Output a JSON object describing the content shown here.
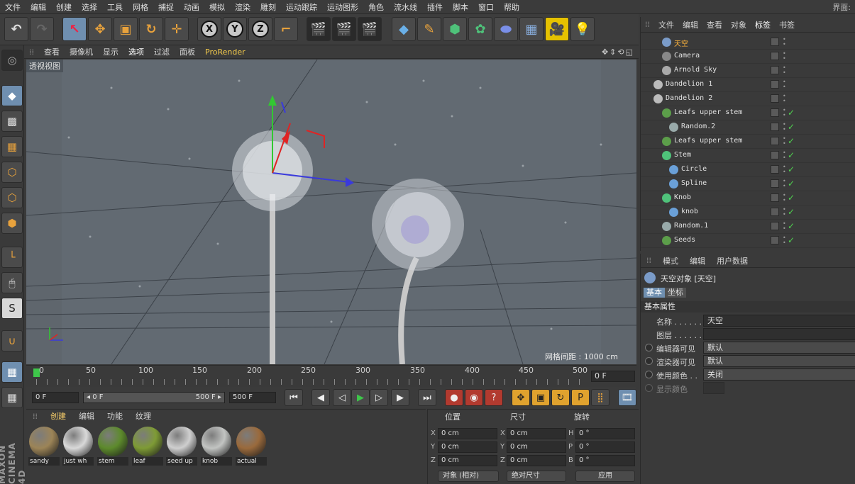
{
  "menubar": {
    "items": [
      "文件",
      "编辑",
      "创建",
      "选择",
      "工具",
      "网格",
      "捕捉",
      "动画",
      "模拟",
      "渲染",
      "雕刻",
      "运动跟踪",
      "运动图形",
      "角色",
      "流水线",
      "插件",
      "脚本",
      "窗口",
      "帮助"
    ],
    "layout_label": "界面:"
  },
  "toolbar": {
    "axis_x": "X",
    "axis_y": "Y",
    "axis_z": "Z"
  },
  "viewport": {
    "menu": [
      "查看",
      "摄像机",
      "显示",
      "选项",
      "过滤",
      "面板",
      "ProRender"
    ],
    "label": "透视视图",
    "grid_spacing": "网格间距 : 1000 cm"
  },
  "timeline": {
    "ticks": [
      "0",
      "50",
      "100",
      "150",
      "200",
      "250",
      "300",
      "350",
      "400",
      "450",
      "500"
    ],
    "current_frame": "0 F"
  },
  "transport": {
    "start_field": "0 F",
    "range_start": "◂ 0 F",
    "range_end": "500 F ▸",
    "end_field": "500 F"
  },
  "materials": {
    "tabs": [
      "创建",
      "编辑",
      "功能",
      "纹理"
    ],
    "items": [
      {
        "name": "sandy",
        "color": "#9c8457"
      },
      {
        "name": "just wh",
        "color": "#d9d9d9"
      },
      {
        "name": "stem",
        "color": "#5d8a2c"
      },
      {
        "name": "leaf",
        "color": "#7e9b35"
      },
      {
        "name": "seed up",
        "color": "#cfcfcf"
      },
      {
        "name": "knob",
        "color": "#c2c4c2"
      },
      {
        "name": "actual",
        "color": "#9a6a3c"
      }
    ]
  },
  "coords": {
    "headers": [
      "位置",
      "尺寸",
      "旋转"
    ],
    "rows": [
      {
        "l1": "X",
        "v1": "0 cm",
        "l2": "X",
        "v2": "0 cm",
        "l3": "H",
        "v3": "0 °"
      },
      {
        "l1": "Y",
        "v1": "0 cm",
        "l2": "Y",
        "v2": "0 cm",
        "l3": "P",
        "v3": "0 °"
      },
      {
        "l1": "Z",
        "v1": "0 cm",
        "l2": "Z",
        "v2": "0 cm",
        "l3": "B",
        "v3": "0 °"
      }
    ],
    "mode_select": "对象 (相对)",
    "size_select": "绝对尺寸",
    "apply": "应用"
  },
  "object_manager": {
    "menu": [
      "文件",
      "编辑",
      "查看",
      "对象",
      "标签",
      "书签"
    ],
    "objects": [
      {
        "name": "天空",
        "selected": true,
        "color": "#7a9bc8",
        "check": false
      },
      {
        "name": "Camera",
        "selected": false,
        "color": "#888",
        "check": false
      },
      {
        "name": "Arnold Sky",
        "selected": false,
        "color": "#aaa",
        "check": false
      },
      {
        "name": "Dandelion 1",
        "selected": false,
        "color": "#bbb",
        "check": false
      },
      {
        "name": "Dandelion 2",
        "selected": false,
        "color": "#bbb",
        "check": false
      },
      {
        "name": "Leafs upper stem",
        "selected": false,
        "color": "#5c9e4a",
        "check": true
      },
      {
        "name": "Random.2",
        "selected": false,
        "color": "#9aa",
        "check": true
      },
      {
        "name": "Leafs upper stem",
        "selected": false,
        "color": "#5c9e4a",
        "check": true
      },
      {
        "name": "Stem",
        "selected": false,
        "color": "#4fc27a",
        "check": true
      },
      {
        "name": "Circle",
        "selected": false,
        "color": "#6aa0d8",
        "check": true
      },
      {
        "name": "Spline",
        "selected": false,
        "color": "#6aa0d8",
        "check": true
      },
      {
        "name": "Knob",
        "selected": false,
        "color": "#4fc27a",
        "check": true
      },
      {
        "name": "knob",
        "selected": false,
        "color": "#6aa0d8",
        "check": true
      },
      {
        "name": "Random.1",
        "selected": false,
        "color": "#9aa",
        "check": true
      },
      {
        "name": "Seeds",
        "selected": false,
        "color": "#5c9e4a",
        "check": true
      }
    ]
  },
  "attribute_manager": {
    "menu": [
      "模式",
      "编辑",
      "用户数据"
    ],
    "title": "天空对象 [天空]",
    "tabs": [
      "基本",
      "坐标"
    ],
    "section": "基本属性",
    "fields": [
      {
        "label": "名称 . . . . . .",
        "value": "天空"
      },
      {
        "label": "图层 . . . . . .",
        "value": ""
      },
      {
        "label": "编辑器可见",
        "value": "默认"
      },
      {
        "label": "渲染器可见",
        "value": "默认"
      },
      {
        "label": "使用颜色 . .",
        "value": "关闭"
      },
      {
        "label": "显示颜色",
        "value": ""
      }
    ]
  },
  "brand": "MAXON CINEMA 4D"
}
